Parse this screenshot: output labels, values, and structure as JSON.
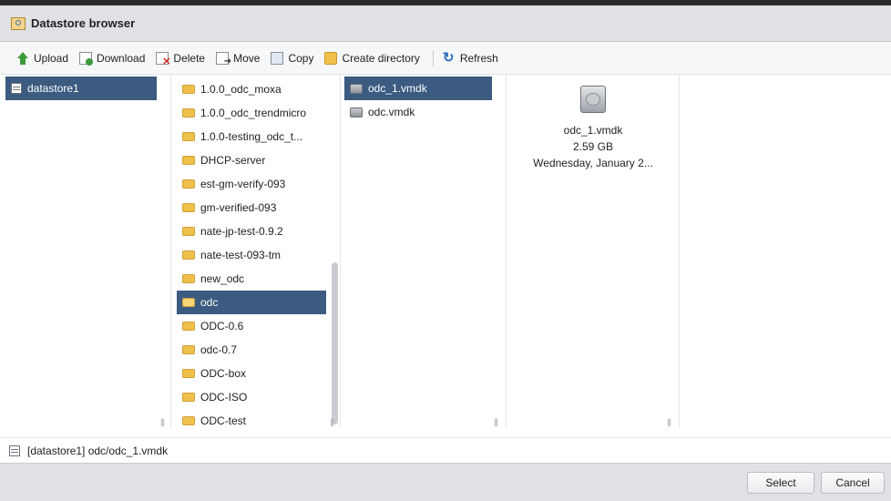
{
  "window": {
    "title": "Datastore browser"
  },
  "toolbar": {
    "upload": "Upload",
    "download": "Download",
    "delete": "Delete",
    "move": "Move",
    "copy": "Copy",
    "create_directory": "Create directory",
    "refresh": "Refresh"
  },
  "datastores": [
    {
      "label": "datastore1",
      "selected": true
    }
  ],
  "folders": [
    {
      "label": "1.0.0_odc_moxa"
    },
    {
      "label": "1.0.0_odc_trendmicro"
    },
    {
      "label": "1.0.0-testing_odc_t..."
    },
    {
      "label": "DHCP-server"
    },
    {
      "label": "est-gm-verify-093"
    },
    {
      "label": "gm-verified-093"
    },
    {
      "label": "nate-jp-test-0.9.2"
    },
    {
      "label": "nate-test-093-tm"
    },
    {
      "label": "new_odc"
    },
    {
      "label": "odc",
      "selected": true
    },
    {
      "label": "ODC-0.6"
    },
    {
      "label": "odc-0.7"
    },
    {
      "label": "ODC-box"
    },
    {
      "label": "ODC-ISO"
    },
    {
      "label": "ODC-test"
    }
  ],
  "files": [
    {
      "label": "odc_1.vmdk",
      "selected": true
    },
    {
      "label": "odc.vmdk"
    }
  ],
  "preview": {
    "name": "odc_1.vmdk",
    "size": "2.59 GB",
    "date": "Wednesday, January 2..."
  },
  "status": {
    "path": "[datastore1] odc/odc_1.vmdk"
  },
  "buttons": {
    "select": "Select",
    "cancel": "Cancel"
  },
  "colors": {
    "selection": "#3b5b80",
    "folder": "#efc04a",
    "titlebar": "#dfe1e4"
  }
}
